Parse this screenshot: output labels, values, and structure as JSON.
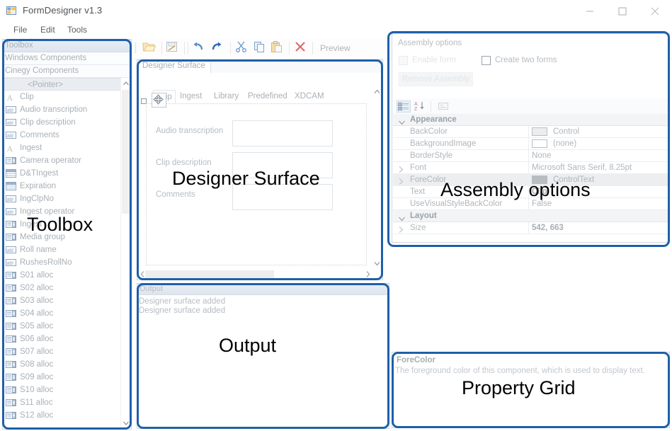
{
  "window": {
    "title": "FormDesigner v1.3",
    "icon": "app-form-icon",
    "buttons": {
      "minimize": "—",
      "maximize": "□",
      "close": "×"
    }
  },
  "menu": {
    "items": [
      "File",
      "Edit",
      "Tools"
    ]
  },
  "toolbar": {
    "items": [
      {
        "name": "open-icon",
        "label": "Open"
      },
      {
        "name": "save-icon",
        "label": "Save"
      },
      {
        "name": "undo-icon",
        "label": "Undo"
      },
      {
        "name": "redo-icon",
        "label": "Redo"
      },
      {
        "name": "cut-icon",
        "label": "Cut"
      },
      {
        "name": "copy-icon",
        "label": "Copy"
      },
      {
        "name": "paste-icon",
        "label": "Paste"
      },
      {
        "name": "delete-icon",
        "label": "Delete"
      }
    ],
    "preview_label": "Preview"
  },
  "toolbox": {
    "header": "Toolbox",
    "categories": [
      "Windows Components",
      "Cinegy Components"
    ],
    "items": [
      {
        "label": "<Pointer>",
        "icon": "pointer-icon",
        "selected": true
      },
      {
        "label": "Clip",
        "icon": "label-icon"
      },
      {
        "label": "Audio transcription",
        "icon": "textbox-icon"
      },
      {
        "label": "Clip description",
        "icon": "textbox-icon"
      },
      {
        "label": "Comments",
        "icon": "textbox-icon"
      },
      {
        "label": "Ingest",
        "icon": "label-icon"
      },
      {
        "label": "Camera operator",
        "icon": "combobox-icon"
      },
      {
        "label": "D&TIngest",
        "icon": "datepicker-icon"
      },
      {
        "label": "Expiration",
        "icon": "datepicker-icon"
      },
      {
        "label": "IngClpNo",
        "icon": "textbox-icon"
      },
      {
        "label": "Ingest operator",
        "icon": "textbox-icon"
      },
      {
        "label": "Ingest",
        "icon": "combobox-icon"
      },
      {
        "label": "Media group",
        "icon": "combobox-icon"
      },
      {
        "label": "Roll name",
        "icon": "textbox-icon"
      },
      {
        "label": "RushesRollNo",
        "icon": "textbox-icon"
      },
      {
        "label": "S01 alloc",
        "icon": "combobox-icon"
      },
      {
        "label": "S02 alloc",
        "icon": "combobox-icon"
      },
      {
        "label": "S03 alloc",
        "icon": "combobox-icon"
      },
      {
        "label": "S04 alloc",
        "icon": "combobox-icon"
      },
      {
        "label": "S05 alloc",
        "icon": "combobox-icon"
      },
      {
        "label": "S06 alloc",
        "icon": "combobox-icon"
      },
      {
        "label": "S07 alloc",
        "icon": "combobox-icon"
      },
      {
        "label": "S08 alloc",
        "icon": "combobox-icon"
      },
      {
        "label": "S09 alloc",
        "icon": "combobox-icon"
      },
      {
        "label": "S10 alloc",
        "icon": "combobox-icon"
      },
      {
        "label": "S11 alloc",
        "icon": "combobox-icon"
      },
      {
        "label": "S12 alloc",
        "icon": "combobox-icon"
      }
    ]
  },
  "designer": {
    "tab_label": "Designer Surface",
    "form_tabs": [
      "Clip",
      "Ingest",
      "Library",
      "Predefined",
      "XDCAM"
    ],
    "active_form_tab": "Clip",
    "fields": [
      {
        "label": "Audio transcription"
      },
      {
        "label": "Clip description"
      },
      {
        "label": "Comments"
      }
    ]
  },
  "output": {
    "header": "Output",
    "lines": [
      "Designer surface added",
      "Designer surface added"
    ]
  },
  "assembly": {
    "title": "Assembly options",
    "enable_form": {
      "label": "Enable form",
      "checked": false,
      "disabled": true
    },
    "create_two_forms": {
      "label": "Create two forms",
      "checked": false,
      "disabled": false
    },
    "remove_button": {
      "label": "Remove Assembly",
      "disabled": true
    }
  },
  "property_grid": {
    "toolbar": [
      {
        "name": "categorized-icon",
        "selected": true
      },
      {
        "name": "alphabetical-sort-icon",
        "selected": false
      },
      {
        "name": "property-pages-icon",
        "selected": false
      }
    ],
    "categories": [
      {
        "name": "Appearance",
        "rows": [
          {
            "name": "BackColor",
            "value": "Control",
            "swatch": "#ededed",
            "expandable": false
          },
          {
            "name": "BackgroundImage",
            "value": "(none)",
            "swatch": "#ffffff",
            "expandable": false
          },
          {
            "name": "BorderStyle",
            "value": "None",
            "expandable": false
          },
          {
            "name": "Font",
            "value": "Microsoft Sans Serif, 8.25pt",
            "expandable": true
          },
          {
            "name": "ForeColor",
            "value": "ControlText",
            "swatch": "#b9bdc2",
            "expandable": true,
            "selected": true
          },
          {
            "name": "Text",
            "value": "Clip",
            "bold": true,
            "expandable": false
          },
          {
            "name": "UseVisualStyleBackColor",
            "value": "False",
            "expandable": false
          }
        ]
      },
      {
        "name": "Layout",
        "rows": [
          {
            "name": "Size",
            "value": "542, 663",
            "bold": true,
            "expandable": true
          }
        ]
      }
    ]
  },
  "forecolor_panel": {
    "title": "ForeColor",
    "description": "The foreground color of this component, which is used to display text."
  },
  "annotations": [
    {
      "id": "toolbox",
      "label": "Toolbox"
    },
    {
      "id": "designer",
      "label": "Designer Surface"
    },
    {
      "id": "output",
      "label": "Output"
    },
    {
      "id": "assembly",
      "label": "Assembly options"
    },
    {
      "id": "property-grid",
      "label": "Property Grid"
    }
  ],
  "colors": {
    "annotation": "#1f5fa9",
    "panel_border": "#cfd6dd",
    "text_muted": "#b0b6bc"
  }
}
